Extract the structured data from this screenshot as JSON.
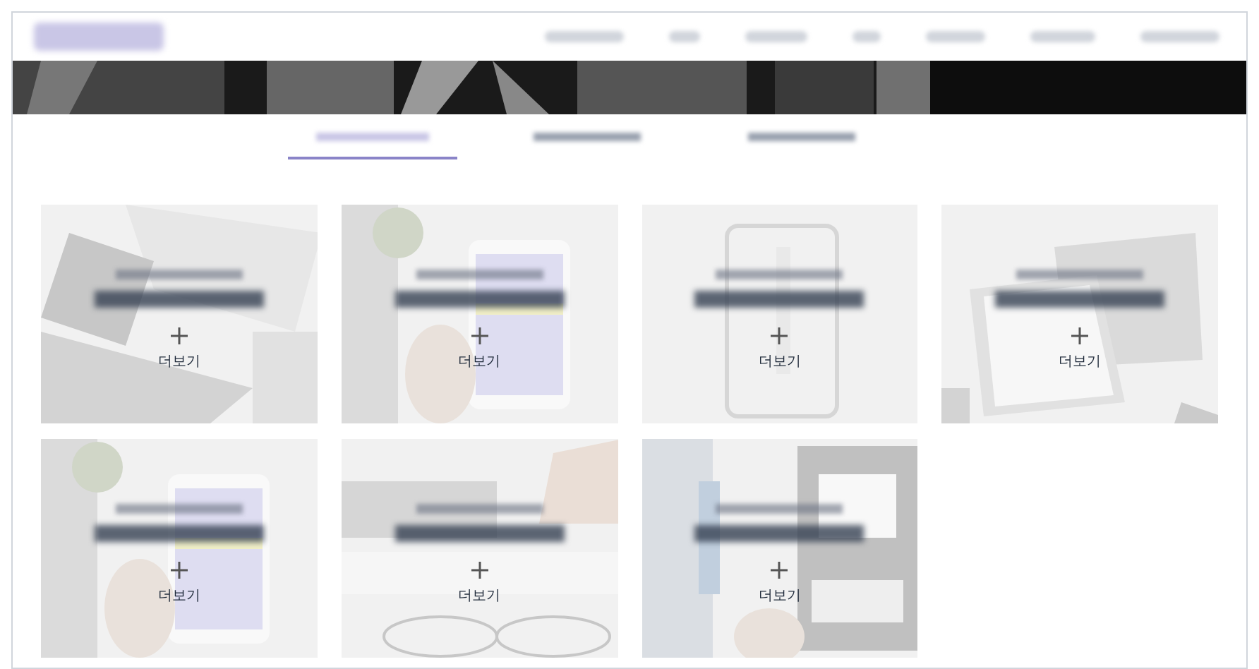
{
  "tabs": [
    {
      "selected": true
    },
    {
      "selected": false
    },
    {
      "selected": false
    }
  ],
  "cards": [
    {
      "more_label": "더보기"
    },
    {
      "more_label": "더보기"
    },
    {
      "more_label": "더보기"
    },
    {
      "more_label": "더보기"
    },
    {
      "more_label": "더보기"
    },
    {
      "more_label": "더보기"
    },
    {
      "more_label": "더보기"
    }
  ]
}
